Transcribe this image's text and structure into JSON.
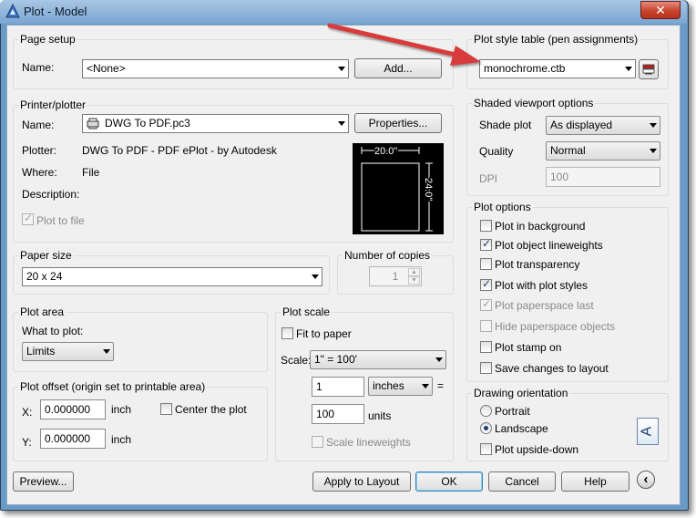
{
  "window": {
    "title": "Plot - Model",
    "close": "✕"
  },
  "page_setup": {
    "title": "Page setup",
    "name_label": "Name:",
    "name_value": "<None>",
    "add_button": "Add..."
  },
  "printer": {
    "title": "Printer/plotter",
    "name_label": "Name:",
    "name_value": "DWG To PDF.pc3",
    "properties_button": "Properties...",
    "plotter_label": "Plotter:",
    "plotter_value": "DWG To PDF - PDF ePlot - by Autodesk",
    "where_label": "Where:",
    "where_value": "File",
    "description_label": "Description:",
    "plot_to_file_label": "Plot to file",
    "plot_to_file_checked": true,
    "preview_width": "20.0\"",
    "preview_height": "24.0\""
  },
  "paper_size": {
    "title": "Paper size",
    "value": "20 x 24"
  },
  "copies": {
    "title": "Number of copies",
    "value": "1"
  },
  "plot_area": {
    "title": "Plot area",
    "what_label": "What to plot:",
    "what_value": "Limits"
  },
  "plot_offset": {
    "title": "Plot offset (origin set to printable area)",
    "x_label": "X:",
    "x_value": "0.000000",
    "x_unit": "inch",
    "y_label": "Y:",
    "y_value": "0.000000",
    "y_unit": "inch",
    "center_label": "Center the plot",
    "center_checked": false
  },
  "plot_scale": {
    "title": "Plot scale",
    "fit_label": "Fit to paper",
    "fit_checked": false,
    "scale_label": "Scale:",
    "scale_value": "1\" = 100'",
    "num_value": "1",
    "unit_value": "inches",
    "equals": "=",
    "den_value": "100",
    "den_unit": "units",
    "lineweights_label": "Scale lineweights",
    "lineweights_checked": false
  },
  "plot_style": {
    "title": "Plot style table (pen assignments)",
    "value": "monochrome.ctb"
  },
  "shaded": {
    "title": "Shaded viewport options",
    "shade_label": "Shade plot",
    "shade_value": "As displayed",
    "quality_label": "Quality",
    "quality_value": "Normal",
    "dpi_label": "DPI",
    "dpi_value": "100"
  },
  "plot_options": {
    "title": "Plot options",
    "items": [
      {
        "label": "Plot in background",
        "checked": false,
        "disabled": false
      },
      {
        "label": "Plot object lineweights",
        "checked": true,
        "disabled": false
      },
      {
        "label": "Plot transparency",
        "checked": false,
        "disabled": false
      },
      {
        "label": "Plot with plot styles",
        "checked": true,
        "disabled": true
      },
      {
        "label": "Plot paperspace last",
        "checked": true,
        "disabled": true
      },
      {
        "label": "Hide paperspace objects",
        "checked": false,
        "disabled": true
      },
      {
        "label": "Plot stamp on",
        "checked": false,
        "disabled": false
      },
      {
        "label": "Save changes to layout",
        "checked": false,
        "disabled": false
      }
    ]
  },
  "orientation": {
    "title": "Drawing orientation",
    "portrait": "Portrait",
    "landscape": "Landscape",
    "selected": "Landscape",
    "upside_down": "Plot upside-down",
    "icon_letter": "A"
  },
  "footer": {
    "preview": "Preview...",
    "apply": "Apply to Layout",
    "ok": "OK",
    "cancel": "Cancel",
    "help": "Help",
    "expand": "‹"
  },
  "colors": {
    "annotation_arrow": "#d83a3a",
    "title_bar": "#7aa6d1",
    "dialog": "#f0f0f0"
  }
}
